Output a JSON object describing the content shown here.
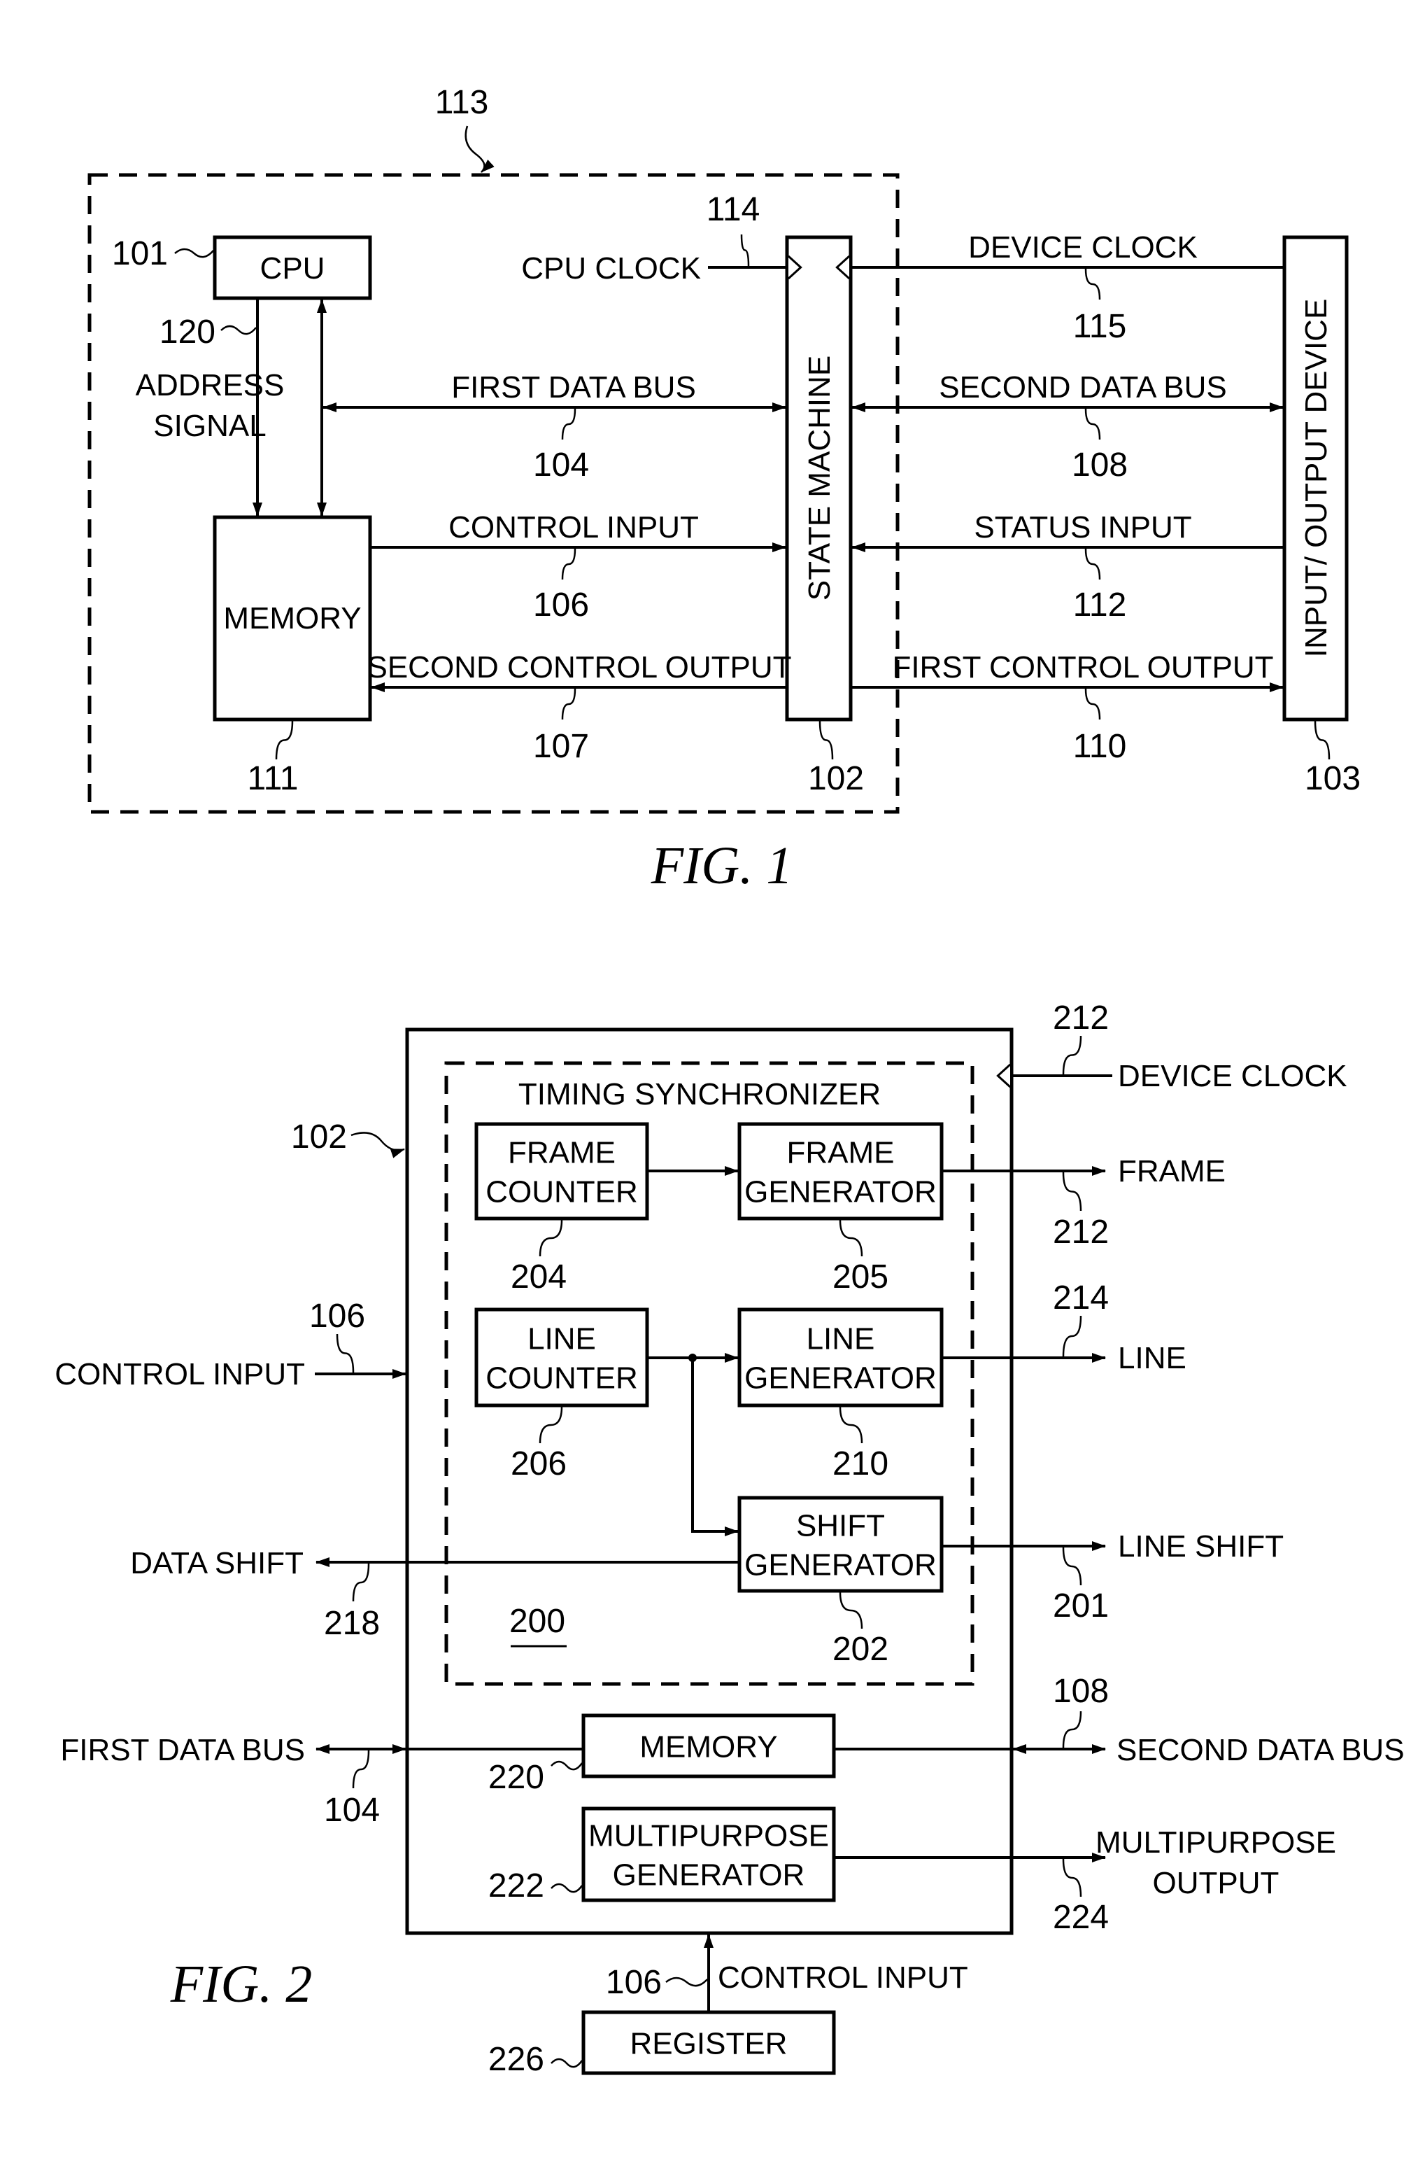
{
  "figures": [
    {
      "id": "fig1",
      "caption": "FIG. 1",
      "group_ref": "113",
      "blocks": [
        {
          "key": "cpu",
          "ref": "101",
          "label": [
            "CPU"
          ]
        },
        {
          "key": "memory",
          "ref": "111",
          "label": [
            "MEMORY"
          ]
        },
        {
          "key": "state_machine",
          "ref": "102",
          "label": [
            "STATE MACHINE"
          ],
          "vertical": true
        },
        {
          "key": "io_device",
          "ref": "103",
          "label": [
            "INPUT/ OUTPUT DEVICE"
          ],
          "vertical": true
        }
      ],
      "signals": [
        {
          "key": "address_signal",
          "ref": "120",
          "label": [
            "ADDRESS",
            "SIGNAL"
          ],
          "from": "cpu",
          "to": "memory",
          "direction": "one-way"
        },
        {
          "key": "cpu_memory_bus",
          "ref": "",
          "label": [],
          "from": "cpu",
          "to": "memory",
          "direction": "bidirectional"
        },
        {
          "key": "cpu_clock",
          "ref": "114",
          "label": [
            "CPU CLOCK"
          ],
          "to": "state_machine",
          "direction": "clock-input"
        },
        {
          "key": "device_clock",
          "ref": "115",
          "label": [
            "DEVICE CLOCK"
          ],
          "from": "io_device",
          "to": "state_machine",
          "direction": "clock-input"
        },
        {
          "key": "first_data_bus",
          "ref": "104",
          "label": [
            "FIRST DATA BUS"
          ],
          "from": "cpu_memory_bus",
          "to": "state_machine",
          "direction": "bidirectional"
        },
        {
          "key": "second_data_bus",
          "ref": "108",
          "label": [
            "SECOND DATA BUS"
          ],
          "from": "state_machine",
          "to": "io_device",
          "direction": "bidirectional"
        },
        {
          "key": "control_input",
          "ref": "106",
          "label": [
            "CONTROL INPUT"
          ],
          "from": "memory",
          "to": "state_machine",
          "direction": "one-way"
        },
        {
          "key": "status_input",
          "ref": "112",
          "label": [
            "STATUS INPUT"
          ],
          "from": "io_device",
          "to": "state_machine",
          "direction": "one-way"
        },
        {
          "key": "second_control_output",
          "ref": "107",
          "label": [
            "SECOND CONTROL OUTPUT"
          ],
          "from": "state_machine",
          "to": "memory",
          "direction": "one-way"
        },
        {
          "key": "first_control_output",
          "ref": "110",
          "label": [
            "FIRST CONTROL OUTPUT"
          ],
          "from": "state_machine",
          "to": "io_device",
          "direction": "one-way"
        }
      ]
    },
    {
      "id": "fig2",
      "caption": "FIG. 2",
      "container_ref": "102",
      "sub_group": {
        "ref": "200",
        "title": "TIMING SYNCHRONIZER"
      },
      "blocks": [
        {
          "key": "frame_counter",
          "ref": "204",
          "label": [
            "FRAME",
            "COUNTER"
          ]
        },
        {
          "key": "frame_generator",
          "ref": "205",
          "label": [
            "FRAME",
            "GENERATOR"
          ]
        },
        {
          "key": "line_counter",
          "ref": "206",
          "label": [
            "LINE",
            "COUNTER"
          ]
        },
        {
          "key": "line_generator",
          "ref": "210",
          "label": [
            "LINE",
            "GENERATOR"
          ]
        },
        {
          "key": "shift_generator",
          "ref": "202",
          "label": [
            "SHIFT",
            "GENERATOR"
          ]
        },
        {
          "key": "memory",
          "ref": "220",
          "label": [
            "MEMORY"
          ]
        },
        {
          "key": "multipurpose_generator",
          "ref": "222",
          "label": [
            "MULTIPURPOSE",
            "GENERATOR"
          ]
        },
        {
          "key": "register",
          "ref": "226",
          "label": [
            "REGISTER"
          ]
        }
      ],
      "signals": [
        {
          "key": "device_clock",
          "ref": "212",
          "label": [
            "DEVICE CLOCK"
          ],
          "direction": "clock-input"
        },
        {
          "key": "frame",
          "ref": "212",
          "label": [
            "FRAME"
          ],
          "from": "frame_generator",
          "direction": "output"
        },
        {
          "key": "line",
          "ref": "214",
          "label": [
            "LINE"
          ],
          "from": "line_generator",
          "direction": "output"
        },
        {
          "key": "line_shift",
          "ref": "201",
          "label": [
            "LINE SHIFT"
          ],
          "from": "shift_generator",
          "direction": "output"
        },
        {
          "key": "data_shift",
          "ref": "218",
          "label": [
            "DATA SHIFT"
          ],
          "from": "shift_generator",
          "direction": "output"
        },
        {
          "key": "control_input_left",
          "ref": "106",
          "label": [
            "CONTROL INPUT"
          ],
          "direction": "input"
        },
        {
          "key": "first_data_bus",
          "ref": "104",
          "label": [
            "FIRST DATA BUS"
          ],
          "direction": "bidirectional"
        },
        {
          "key": "second_data_bus",
          "ref": "108",
          "label": [
            "SECOND DATA BUS"
          ],
          "direction": "bidirectional"
        },
        {
          "key": "multipurpose_output",
          "ref": "224",
          "label": [
            "MULTIPURPOSE",
            "OUTPUT"
          ],
          "from": "multipurpose_generator",
          "direction": "output"
        },
        {
          "key": "control_input_bottom",
          "ref": "106",
          "label": [
            "CONTROL INPUT"
          ],
          "from": "register",
          "direction": "input"
        }
      ]
    }
  ]
}
